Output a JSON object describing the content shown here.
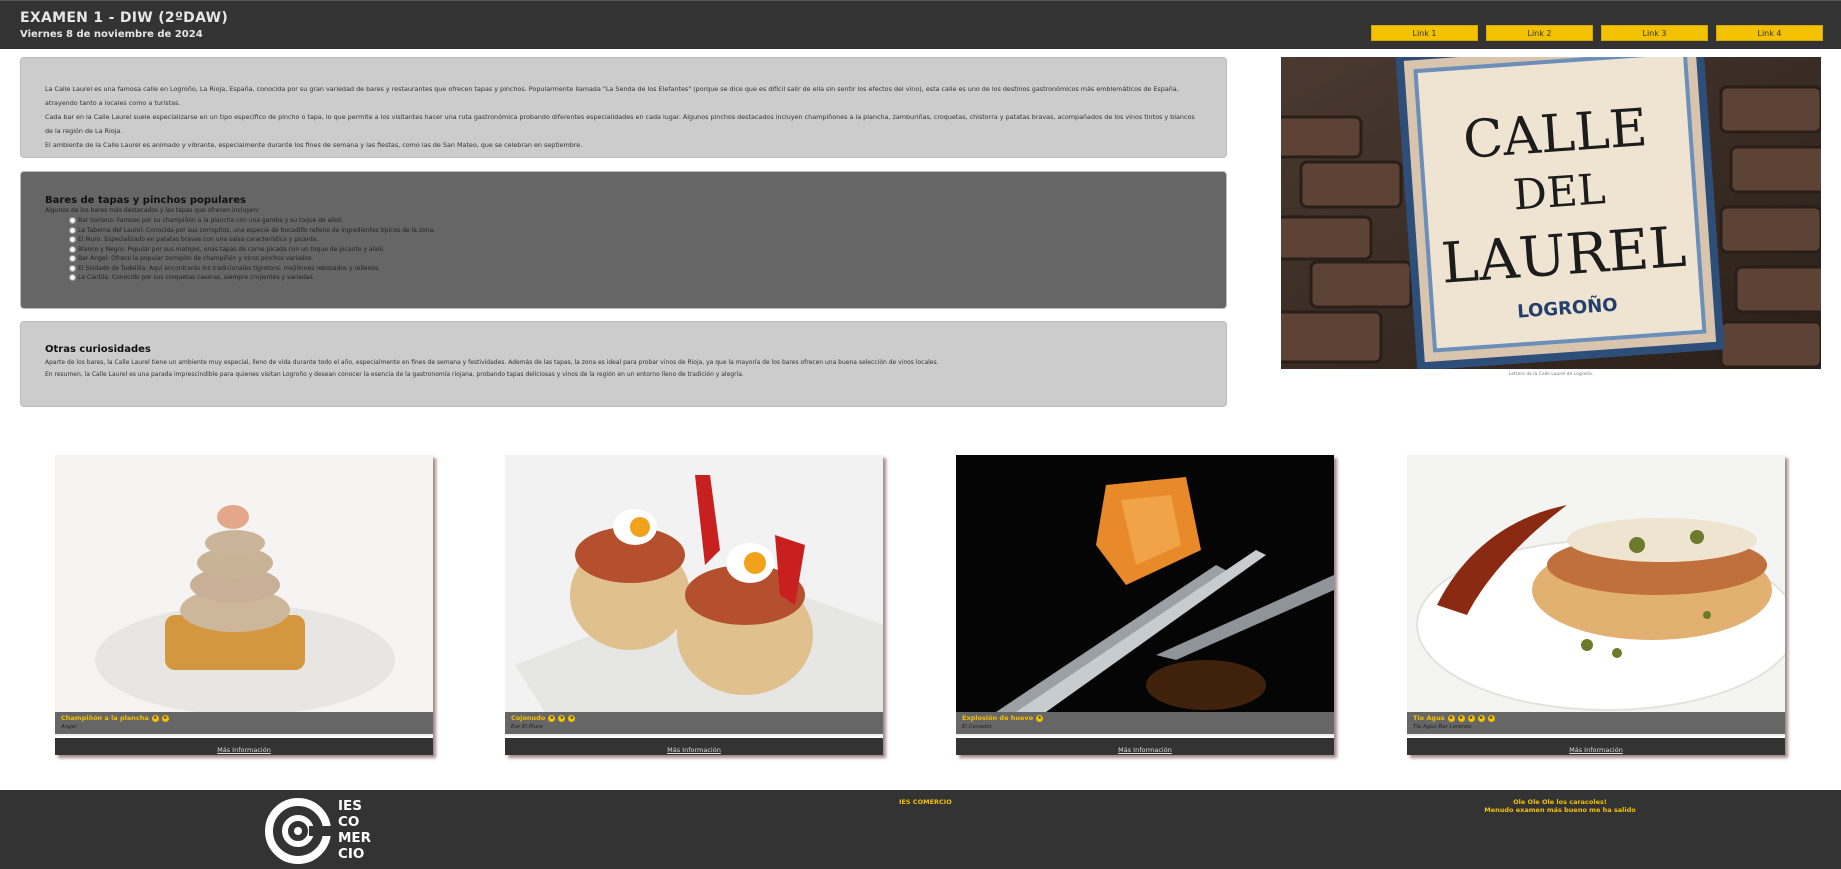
{
  "header": {
    "title": "EXAMEN 1 - DIW (2ºDAW)",
    "date": "Viernes 8 de noviembre de 2024",
    "links": [
      "Link 1",
      "Link 2",
      "Link 3",
      "Link 4"
    ]
  },
  "intro": {
    "paragraphs": [
      "La Calle Laurel es una famosa calle en Logroño, La Rioja, España, conocida por su gran variedad de bares y restaurantes que ofrecen tapas y pinchos. Popularmente llamada \"La Senda de los Elefantes\" (porque se dice que es difícil salir de ella sin sentir los efectos del vino), esta calle es uno de los destinos gastronómicos más emblemáticos de España, atrayendo tanto a locales como a turistas.",
      "Cada bar en la Calle Laurel suele especializarse en un tipo específico de pincho o tapa, lo que permite a los visitantes hacer una ruta gastronómica probando diferentes especialidades en cada lugar. Algunos pinchos destacados incluyen champiñones a la plancha, zamburiñas, croquetas, chistorra y patatas bravas, acompañados de los vinos tintos y blancos de la región de La Rioja.",
      "El ambiente de la Calle Laurel es animado y vibrante, especialmente durante los fines de semana y las fiestas, como las de San Mateo, que se celebran en septiembre."
    ]
  },
  "bars": {
    "title": "Bares de tapas y pinchos populares",
    "intro": "Algunos de los bares más destacados y las tapas que ofrecen incluyen:",
    "items": [
      "Bar Soriano: Famoso por su champiñón a la plancha con una gamba y su toque de alioli.",
      "La Taberna del Laurel: Conocida por sus zorropitos, una especie de bocadillo relleno de ingredientes típicos de la zona.",
      "El Muro: Especializado en patatas bravas con una salsa característica y picante.",
      "Blanco y Negro: Popular por sus matojos, unas tapas de carne picada con un toque de picante y alioli.",
      "Bar Ángel: Ofrece la popular zorropito de champiñón y otros pinchos variados.",
      "El Soldado de Tudelilla: Aquí encontrarás los tradicionales tigretons, mejillones rebozados y rellenos.",
      "La Cantila: Conocido por sus croquetas caseras, siempre crujientes y variadas."
    ]
  },
  "curiosities": {
    "title": "Otras curiosidades",
    "paragraphs": [
      "Aparte de los bares, la Calle Laurel tiene un ambiente muy especial, lleno de vida durante todo el año, especialmente en fines de semana y festividades. Además de las tapas, la zona es ideal para probar vinos de Rioja, ya que la mayoría de los bares ofrecen una buena selección de vinos locales.",
      "En resumen, la Calle Laurel es una parada imprescindible para quienes visitan Logroño y desean conocer la esencia de la gastronomía riojana, probando tapas deliciosas y vinos de la región en un entorno lleno de tradición y alegría."
    ]
  },
  "hero": {
    "sign_line1": "CALLE",
    "sign_line2": "DEL",
    "sign_line3": "LAUREL",
    "sign_city": "LOGROÑO",
    "caption": "Letrero de la Calle Laurel de Logroño."
  },
  "cards": [
    {
      "title": "Champiñón a la plancha",
      "stars": 2,
      "bar": "Angel",
      "more": "Más Información"
    },
    {
      "title": "Cojonudo",
      "stars": 3,
      "bar": "Bar El Muro",
      "more": "Más Información"
    },
    {
      "title": "Explosión de huevo",
      "stars": 1,
      "bar": "El Cenador",
      "more": "Más Información"
    },
    {
      "title": "Tío Agus",
      "stars": 5,
      "bar": "Tío Agus Bar Lorenzo",
      "more": "Más Información"
    }
  ],
  "footer": {
    "logo_lines": [
      "IES",
      "CO",
      "MER",
      "CIO"
    ],
    "center": "IES COMERCIO",
    "right_line1": "Ole Ole Ole los caracoles!",
    "right_line2": "Menudo examen más bueno me ha salido"
  },
  "colors": {
    "accent": "#f2c100",
    "dark": "#333333",
    "panel_light": "#cccccc",
    "panel_dark": "#666666"
  }
}
